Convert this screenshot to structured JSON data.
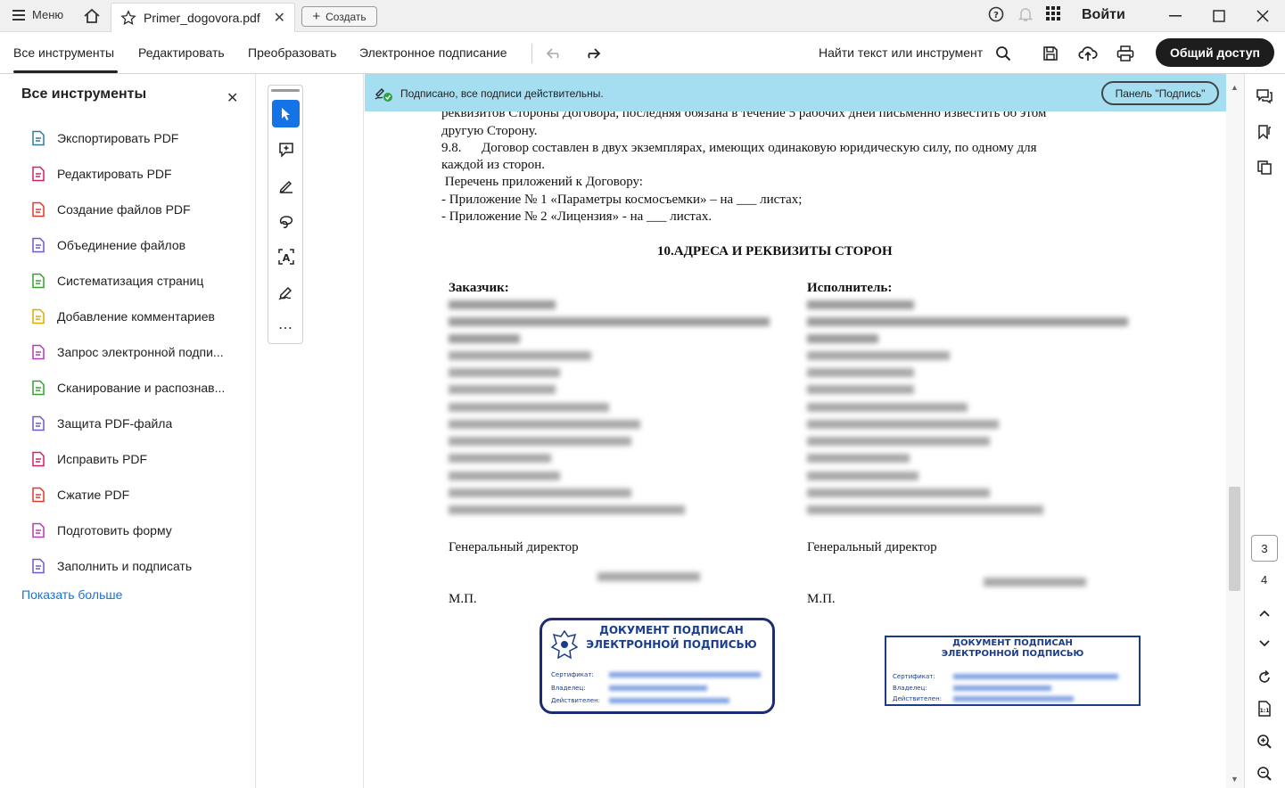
{
  "titlebar": {
    "menu_label": "Меню",
    "tab_name": "Primer_dogovora.pdf",
    "create_label": "Создать",
    "login_label": "Войти"
  },
  "toolbar": {
    "tabs": [
      "Все инструменты",
      "Редактировать",
      "Преобразовать",
      "Электронное подписание"
    ],
    "find_label": "Найти текст или инструмент",
    "share_label": "Общий доступ"
  },
  "left_panel": {
    "title": "Все инструменты",
    "items": [
      {
        "label": "Экспортировать PDF",
        "color": "#2e7d9a"
      },
      {
        "label": "Редактировать PDF",
        "color": "#d1206b"
      },
      {
        "label": "Создание файлов PDF",
        "color": "#e0372f"
      },
      {
        "label": "Объединение файлов",
        "color": "#6a5acd"
      },
      {
        "label": "Систематизация страниц",
        "color": "#37a12e"
      },
      {
        "label": "Добавление комментариев",
        "color": "#e0a800"
      },
      {
        "label": "Запрос электронной подпи...",
        "color": "#b03cb0"
      },
      {
        "label": "Сканирование и распознав...",
        "color": "#37a12e"
      },
      {
        "label": "Защита PDF-файла",
        "color": "#6a5acd"
      },
      {
        "label": "Исправить PDF",
        "color": "#d1206b"
      },
      {
        "label": "Сжатие PDF",
        "color": "#e0372f"
      },
      {
        "label": "Подготовить форму",
        "color": "#b03cb0"
      },
      {
        "label": "Заполнить и подписать",
        "color": "#6a5acd"
      }
    ],
    "show_more": "Показать больше"
  },
  "signature_bar": {
    "text": "Подписано, все подписи действительны.",
    "panel_button": "Панель \"Подпись\""
  },
  "document": {
    "lines": [
      "реквизитов Стороны Договора, последняя обязана в течение 5 рабочих дней письменно известить об этом",
      "другую Сторону.",
      "9.8.      Договор составлен в двух экземплярах, имеющих одинаковую юридическую силу, по одному для",
      "каждой из сторон.",
      " Перечень приложений к Договору:",
      "- Приложение № 1 «Параметры космосъемки» – на ___ листах;",
      "- Приложение № 2 «Лицензия» - на ___ листах."
    ],
    "section_title": "10.АДРЕСА И РЕКВИЗИТЫ СТОРОН",
    "customer_label": "Заказчик:",
    "executor_label": "Исполнитель:",
    "director_label": "Генеральный директор",
    "mp_label": "М.П.",
    "stamp_title_1": "ДОКУМЕНТ ПОДПИСАН",
    "stamp_title_2": "ЭЛЕКТРОННОЙ ПОДПИСЬЮ",
    "stamp_cert": "Сертификат:",
    "stamp_owner": "Владелец:",
    "stamp_valid": "Действителен:"
  },
  "right_panel": {
    "current_page": "3",
    "next_page": "4"
  },
  "colors": {
    "accent": "#1473e6",
    "signature_bar": "#a6def1",
    "share_button": "#1d1d1d",
    "stamp_blue": "#1b3c8a"
  }
}
